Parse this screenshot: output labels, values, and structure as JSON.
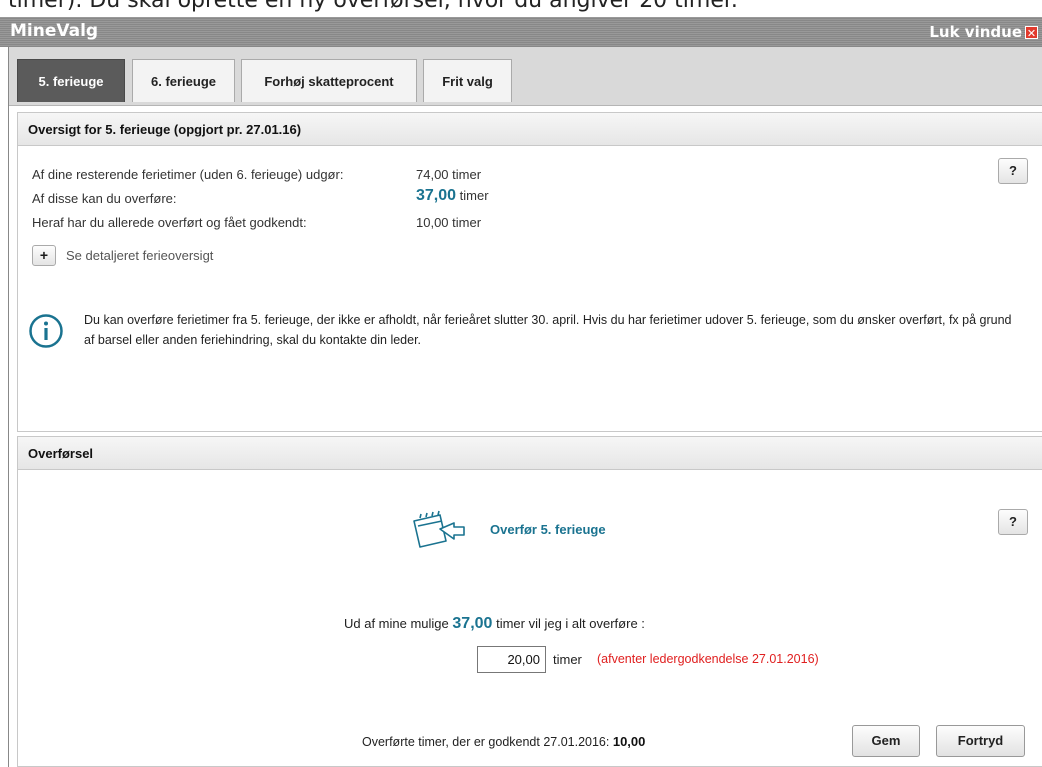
{
  "top_strip": {
    "text": "timer). Du skal oprette en ny overførsel, hvor du angiver 20 timer."
  },
  "window": {
    "title": "MineValg",
    "close_label": "Luk vindue",
    "close_symbol": "✕"
  },
  "tabs": [
    {
      "label": "5. ferieuge",
      "active": true
    },
    {
      "label": "6. ferieuge",
      "active": false
    },
    {
      "label": "Forhøj skatteprocent",
      "active": false
    },
    {
      "label": "Frit valg",
      "active": false
    }
  ],
  "overview": {
    "header": "Oversigt for 5. ferieuge (opgjort pr. 27.01.16)",
    "help_label": "?",
    "rows": [
      {
        "label": "Af dine resterende ferietimer (uden 6. ferieuge) udgør:",
        "value": "74,00 timer"
      },
      {
        "label": "Af disse kan du overføre:",
        "value_number": "37,00",
        "value_unit": "timer"
      },
      {
        "label": "Heraf har du allerede overført og fået godkendt:",
        "value": "10,00 timer"
      }
    ],
    "expand_label": "+",
    "detail_link": "Se detaljeret ferieoversigt",
    "info_text": "Du kan overføre ferietimer fra 5. ferieuge, der ikke er afholdt, når ferieåret slutter 30. april. Hvis du har ferietimer udover 5. ferieuge, som du ønsker overført, fx på grund af barsel eller anden feriehindring, skal du kontakte din leder."
  },
  "transfer": {
    "header": "Overførsel",
    "help_label": "?",
    "title": "Overfør 5. ferieuge",
    "prefix": "Ud af mine mulige",
    "possible_hours": "37,00",
    "suffix": "timer vil jeg i alt overføre :",
    "input_value": "20,00",
    "input_unit": "timer",
    "pending_status": "(afventer ledergodkendelse 27.01.2016)",
    "approved_label": "Overførte timer, der er godkendt 27.01.2016:",
    "approved_value": "10,00",
    "save_label": "Gem",
    "cancel_label": "Fortryd"
  },
  "colors": {
    "accent": "#1a7390",
    "pending": "#e02020",
    "active_tab": "#5b5b5b",
    "titlebar": "#939393",
    "close_icon": "#e23b2e"
  }
}
